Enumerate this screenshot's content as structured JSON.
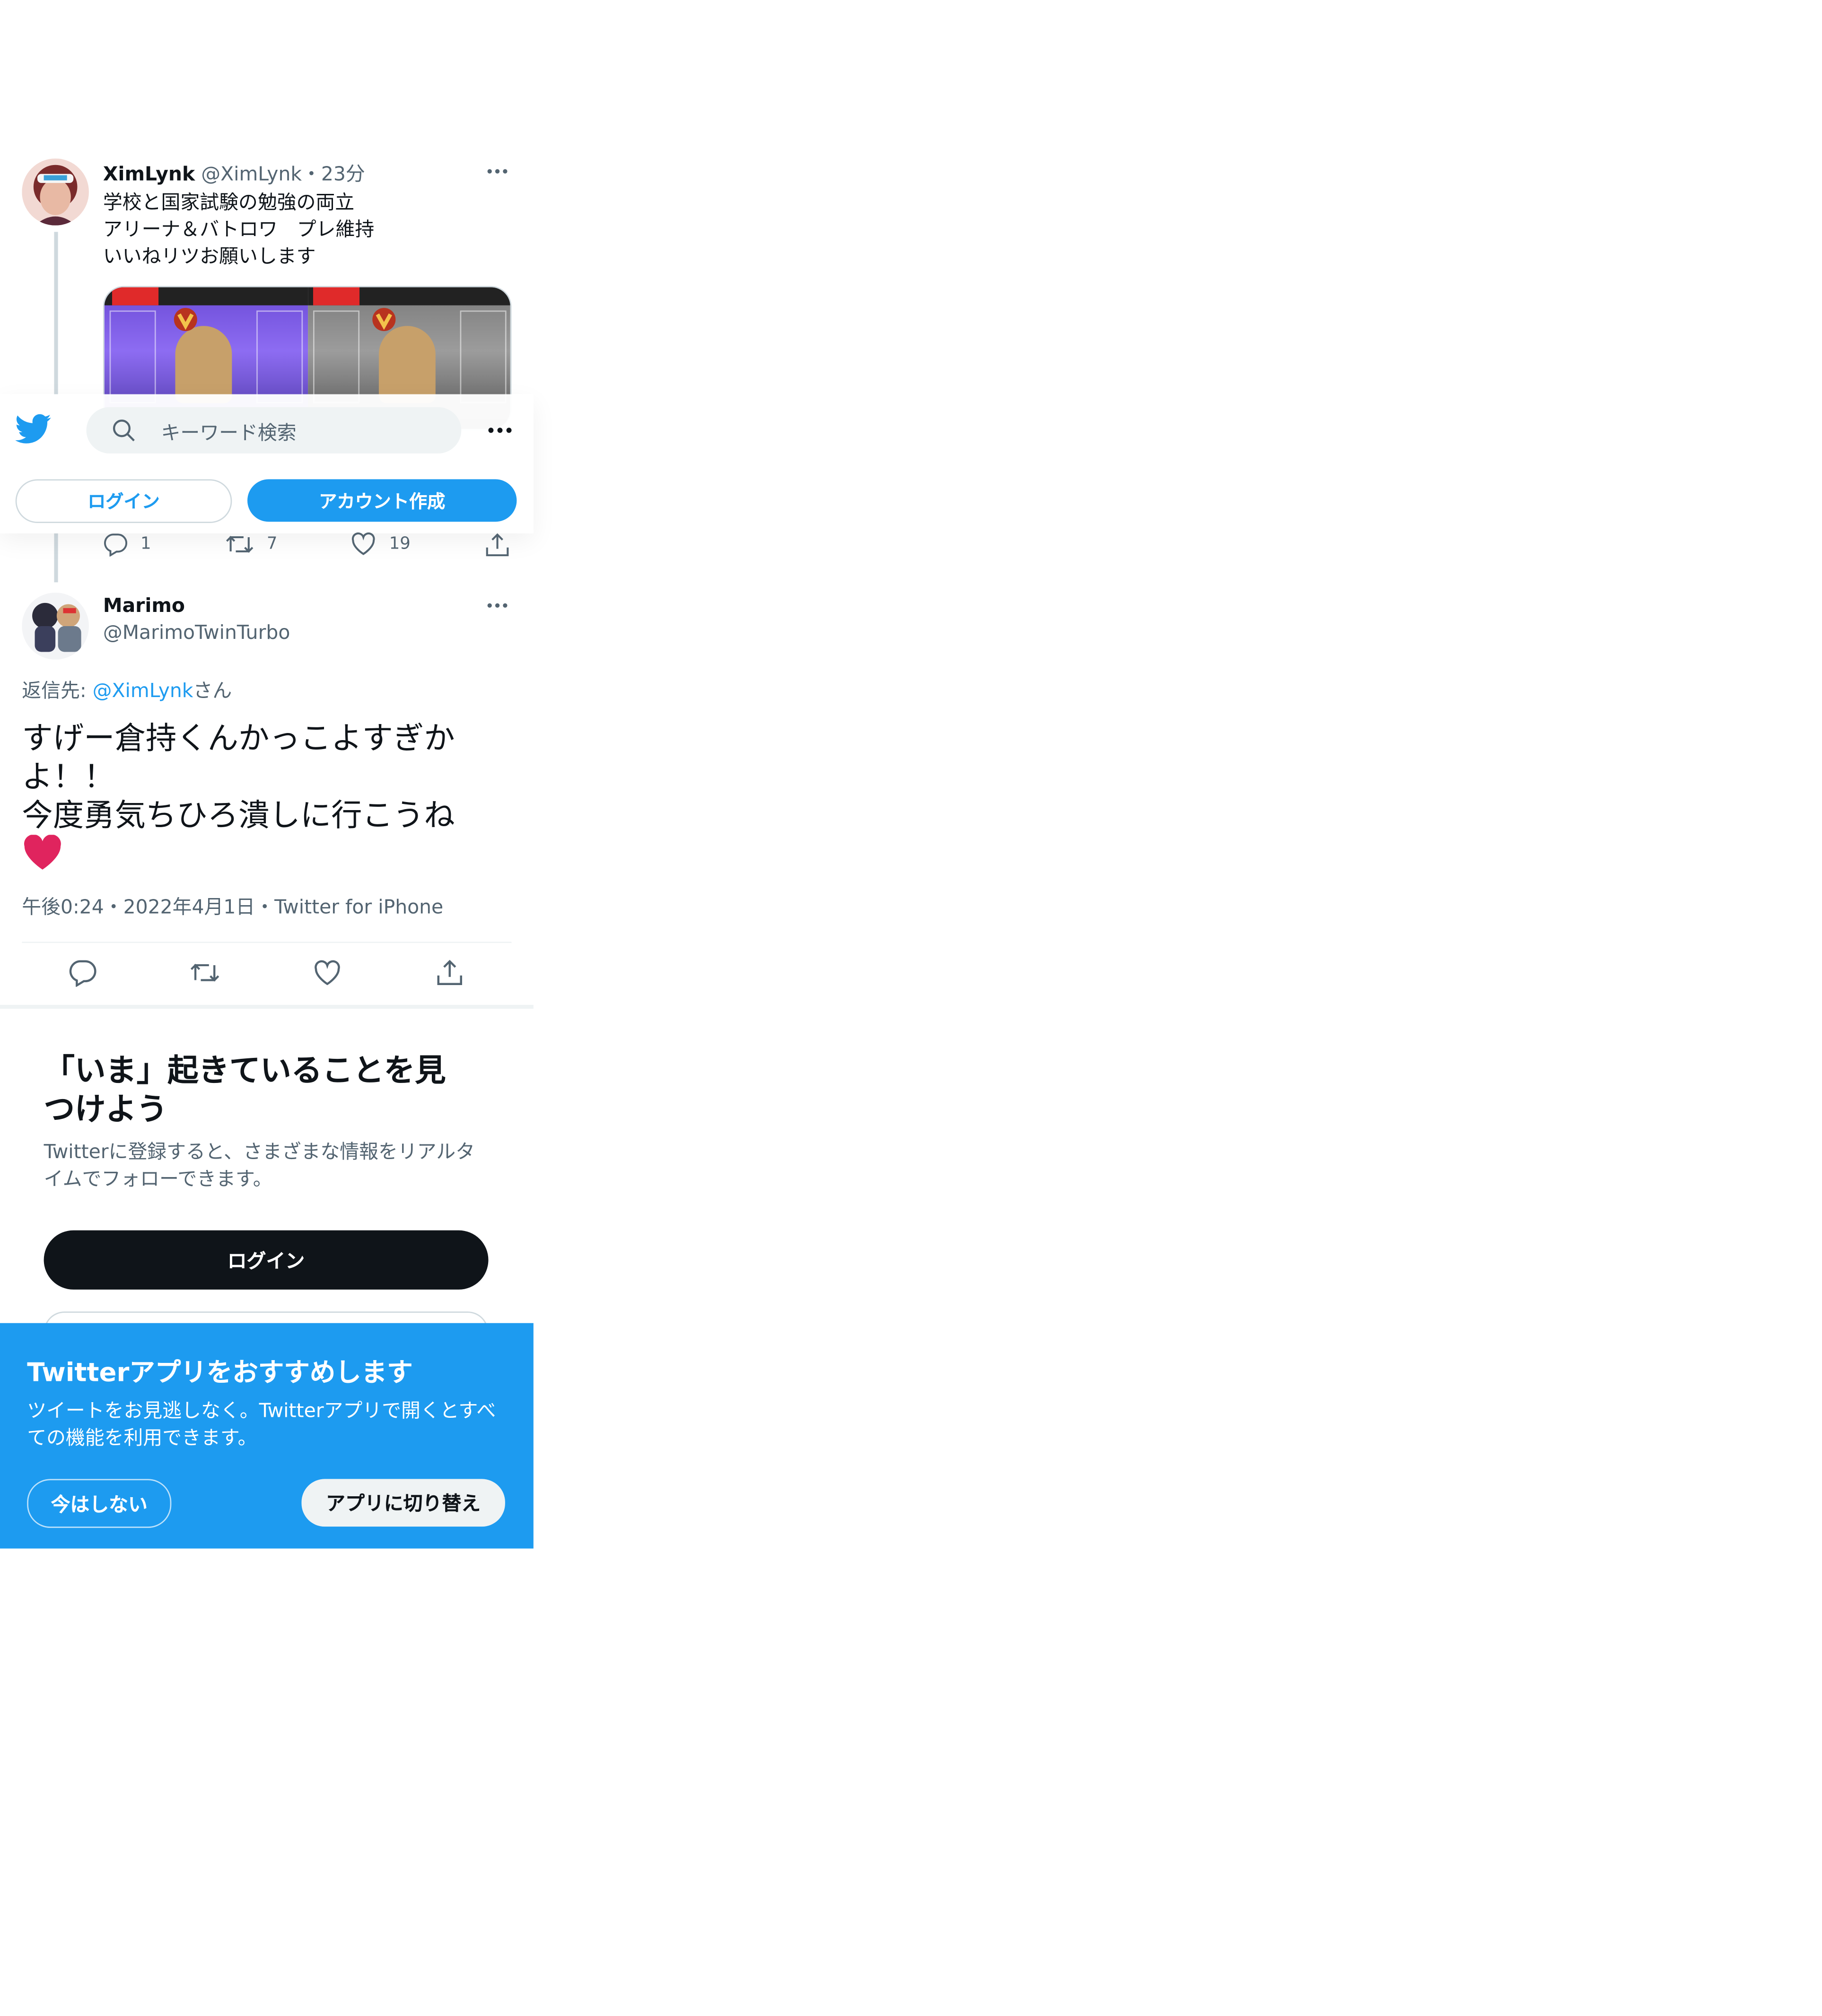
{
  "tweet": {
    "name": "XimLynk",
    "handle": "@XimLynk",
    "time_sep": "・",
    "time": "23分",
    "lines": [
      "学校と国家試験の勉強の両立",
      "アリーナ＆バトロワ　プレ維持",
      "いいねリツお願いします"
    ],
    "counts": {
      "reply": "1",
      "retweet": "7",
      "like": "19"
    }
  },
  "topbar": {
    "search_placeholder": "キーワード検索",
    "login": "ログイン",
    "signup": "アカウント作成"
  },
  "reply": {
    "name": "Marimo",
    "handle": "@MarimoTwinTurbo",
    "reply_to_prefix": "返信先: ",
    "reply_to_handle": "@XimLynk",
    "reply_to_suffix": "さん",
    "text_lines": [
      "すげー倉持くんかっこよすぎか",
      "よ！！",
      "今度勇気ちひろ潰しに行こうね"
    ],
    "meta": "午後0:24・2022年4月1日・Twitter for iPhone"
  },
  "signup_card": {
    "title_lines": [
      "「いま」起きていることを見",
      "つけよう"
    ],
    "subtitle_lines": [
      "Twitterに登録すると、さまざまな情報をリアルタ",
      "イムでフォローできます。"
    ],
    "login": "ログイン"
  },
  "app_banner": {
    "title": "Twitterアプリをおすすめします",
    "lines": [
      "ツイートをお見逃しなく。Twitterアプリで開くとすべ",
      "ての機能を利用できます。"
    ],
    "not_now": "今はしない",
    "switch": "アプリに切り替え"
  },
  "colors": {
    "accent": "#1d9bf0",
    "text": "#0f1419",
    "muted": "#536471",
    "heart": "#e0245e"
  },
  "icons": [
    "twitter-bird-icon",
    "search-icon",
    "more-icon",
    "reply-icon",
    "retweet-icon",
    "like-icon",
    "share-icon",
    "heart-emoji"
  ]
}
